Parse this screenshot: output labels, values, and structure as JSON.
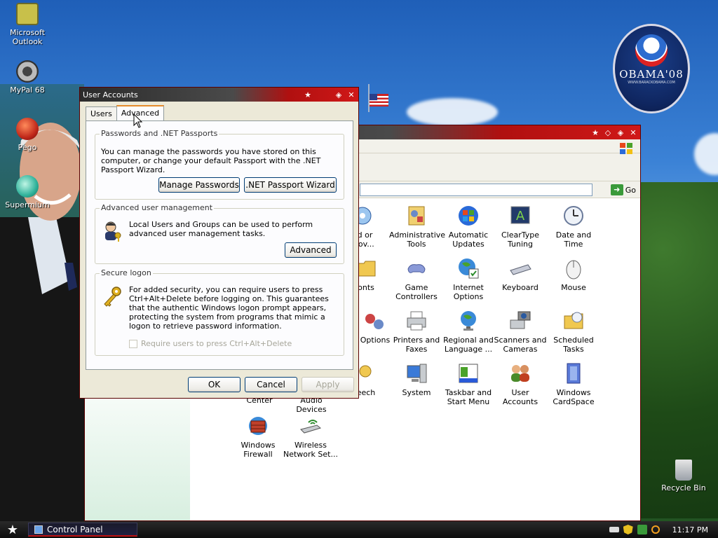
{
  "desktop": {
    "icons": [
      {
        "label": "Microsoft Outlook"
      },
      {
        "label": "MyPal 68"
      },
      {
        "label": "Pego"
      },
      {
        "label": "Supermium"
      },
      {
        "label": "Recycle Bin"
      }
    ],
    "seal": {
      "text": "OBAMA'08",
      "small": "WWW.BARACKOBAMA.COM"
    }
  },
  "control_panel": {
    "go_label": "Go",
    "items": [
      {
        "label": "dd or\nmov..."
      },
      {
        "label": "Administrative Tools"
      },
      {
        "label": "Automatic Updates"
      },
      {
        "label": "ClearType Tuning"
      },
      {
        "label": "Date and Time"
      },
      {
        "label": "onts"
      },
      {
        "label": "Game Controllers"
      },
      {
        "label": "Internet Options"
      },
      {
        "label": "Keyboard"
      },
      {
        "label": "Mouse"
      },
      {
        "label": "Options"
      },
      {
        "label": "Printers and Faxes"
      },
      {
        "label": "Regional and Language ..."
      },
      {
        "label": "Scanners and Cameras"
      },
      {
        "label": "Scheduled Tasks"
      },
      {
        "label": "eech"
      },
      {
        "label": "System"
      },
      {
        "label": "Taskbar and Start Menu"
      },
      {
        "label": "User Accounts"
      },
      {
        "label": "Windows CardSpace"
      },
      {
        "label": "Center"
      },
      {
        "label": "Audio Devices"
      },
      {
        "label": "Windows Firewall"
      },
      {
        "label": "Wireless Network Set..."
      }
    ]
  },
  "dialog": {
    "title": "User Accounts",
    "tabs": [
      "Users",
      "Advanced"
    ],
    "passwords": {
      "legend": "Passwords and .NET Passports",
      "text": "You can manage the passwords you have stored on this computer, or change your default Passport with the .NET Passport Wizard.",
      "manage_btn": "Manage Passwords",
      "wizard_btn": ".NET Passport Wizard"
    },
    "advanced_mgmt": {
      "legend": "Advanced user management",
      "text": "Local Users and Groups can be used to perform advanced user management tasks.",
      "advanced_btn": "Advanced"
    },
    "secure_logon": {
      "legend": "Secure logon",
      "text": "For added security, you can require users to press Ctrl+Alt+Delete before logging on. This guarantees that the authentic Windows logon prompt appears, protecting the system from programs that mimic a logon to retrieve password information.",
      "checkbox": "Require users to press Ctrl+Alt+Delete"
    },
    "ok": "OK",
    "cancel": "Cancel",
    "apply": "Apply"
  },
  "taskbar": {
    "task_label": "Control Panel",
    "clock": "11:17 PM"
  },
  "colors": {
    "title_red": "#d01818",
    "accent_tab": "#e68b2c"
  }
}
